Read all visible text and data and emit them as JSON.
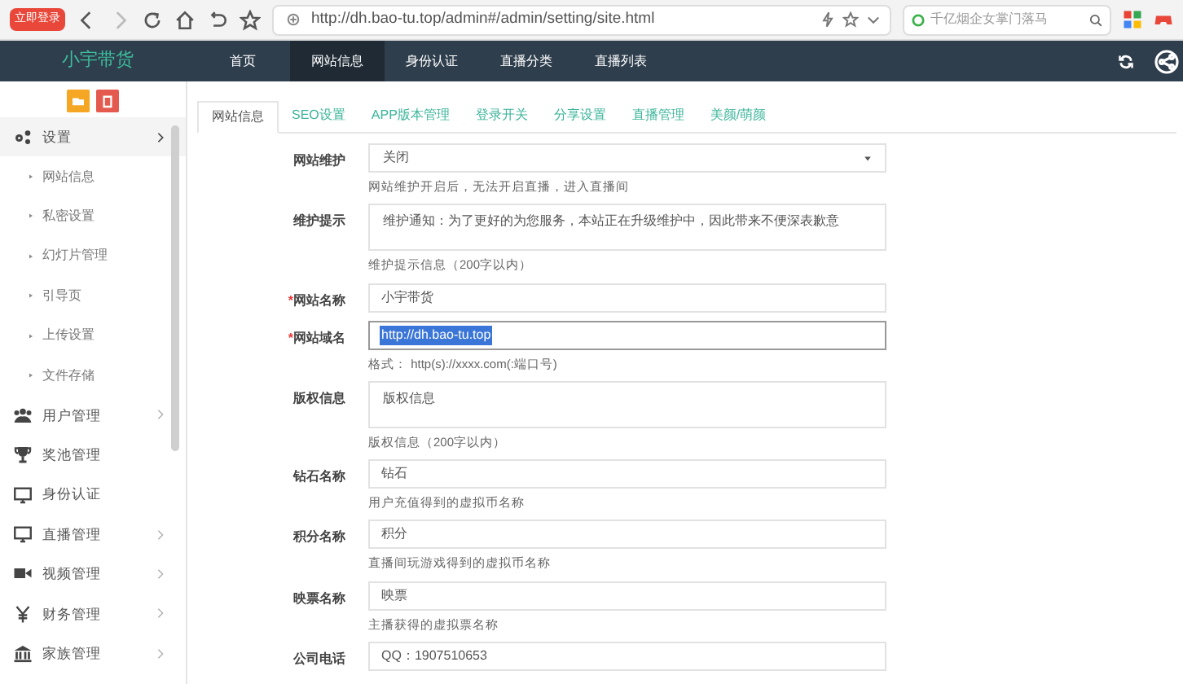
{
  "browser": {
    "login_badge": "立即登录",
    "url": "http://dh.bao-tu.top/admin#/admin/setting/site.html",
    "search": {
      "placeholder": "千亿烟企女掌门落马"
    }
  },
  "navbar": {
    "brand": "小宇带货",
    "items": [
      {
        "label": "首页",
        "selected": false
      },
      {
        "label": "网站信息",
        "selected": true
      },
      {
        "label": "身份认证",
        "selected": false
      },
      {
        "label": "直播分类",
        "selected": false
      },
      {
        "label": "直播列表",
        "selected": false
      }
    ]
  },
  "sidebar": {
    "items": [
      {
        "label": "设置",
        "expanded": true,
        "children": [
          {
            "label": "网站信息"
          },
          {
            "label": "私密设置"
          },
          {
            "label": "幻灯片管理"
          },
          {
            "label": "引导页"
          },
          {
            "label": "上传设置"
          },
          {
            "label": "文件存储"
          }
        ]
      },
      {
        "label": "用户管理",
        "expanded": false
      },
      {
        "label": "奖池管理"
      },
      {
        "label": "身份认证"
      },
      {
        "label": "直播管理",
        "expanded": false
      },
      {
        "label": "视频管理",
        "expanded": false
      },
      {
        "label": "财务管理",
        "expanded": false
      },
      {
        "label": "家族管理",
        "expanded": false
      }
    ]
  },
  "tabs": [
    {
      "label": "网站信息",
      "selected": true
    },
    {
      "label": "SEO设置",
      "selected": false
    },
    {
      "label": "APP版本管理",
      "selected": false
    },
    {
      "label": "登录开关",
      "selected": false
    },
    {
      "label": "分享设置",
      "selected": false
    },
    {
      "label": "直播管理",
      "selected": false
    },
    {
      "label": "美颜/萌颜",
      "selected": false
    }
  ],
  "form": {
    "fields": [
      {
        "kind": "select",
        "label": "网站维护",
        "value": "关闭",
        "hint": "网站维护开启后，无法开启直播，进入直播间"
      },
      {
        "kind": "textarea",
        "label": "维护提示",
        "value": "维护通知：为了更好的为您服务，本站正在升级维护中，因此带来不便深表歉意",
        "hint": "维护提示信息（200字以内）"
      },
      {
        "kind": "input",
        "label": "网站名称",
        "required_mark": "*",
        "value": "小宇带货"
      },
      {
        "kind": "input",
        "label": "网站域名",
        "required_mark": "*",
        "value": "http://dh.bao-tu.top",
        "highlighted": true,
        "hint": "格式： http(s)://xxxx.com(:端口号)"
      },
      {
        "kind": "textarea",
        "label": "版权信息",
        "value": "版权信息",
        "hint": "版权信息（200字以内）"
      },
      {
        "kind": "input",
        "label": "钻石名称",
        "value": "钻石",
        "hint": "用户充值得到的虚拟币名称"
      },
      {
        "kind": "input",
        "label": "积分名称",
        "value": "积分",
        "hint": "直播间玩游戏得到的虚拟币名称"
      },
      {
        "kind": "input",
        "label": "映票名称",
        "value": "映票",
        "hint": "主播获得的虚拟票名称"
      },
      {
        "kind": "input",
        "label": "公司电话",
        "value": "QQ：1907510653"
      }
    ]
  }
}
